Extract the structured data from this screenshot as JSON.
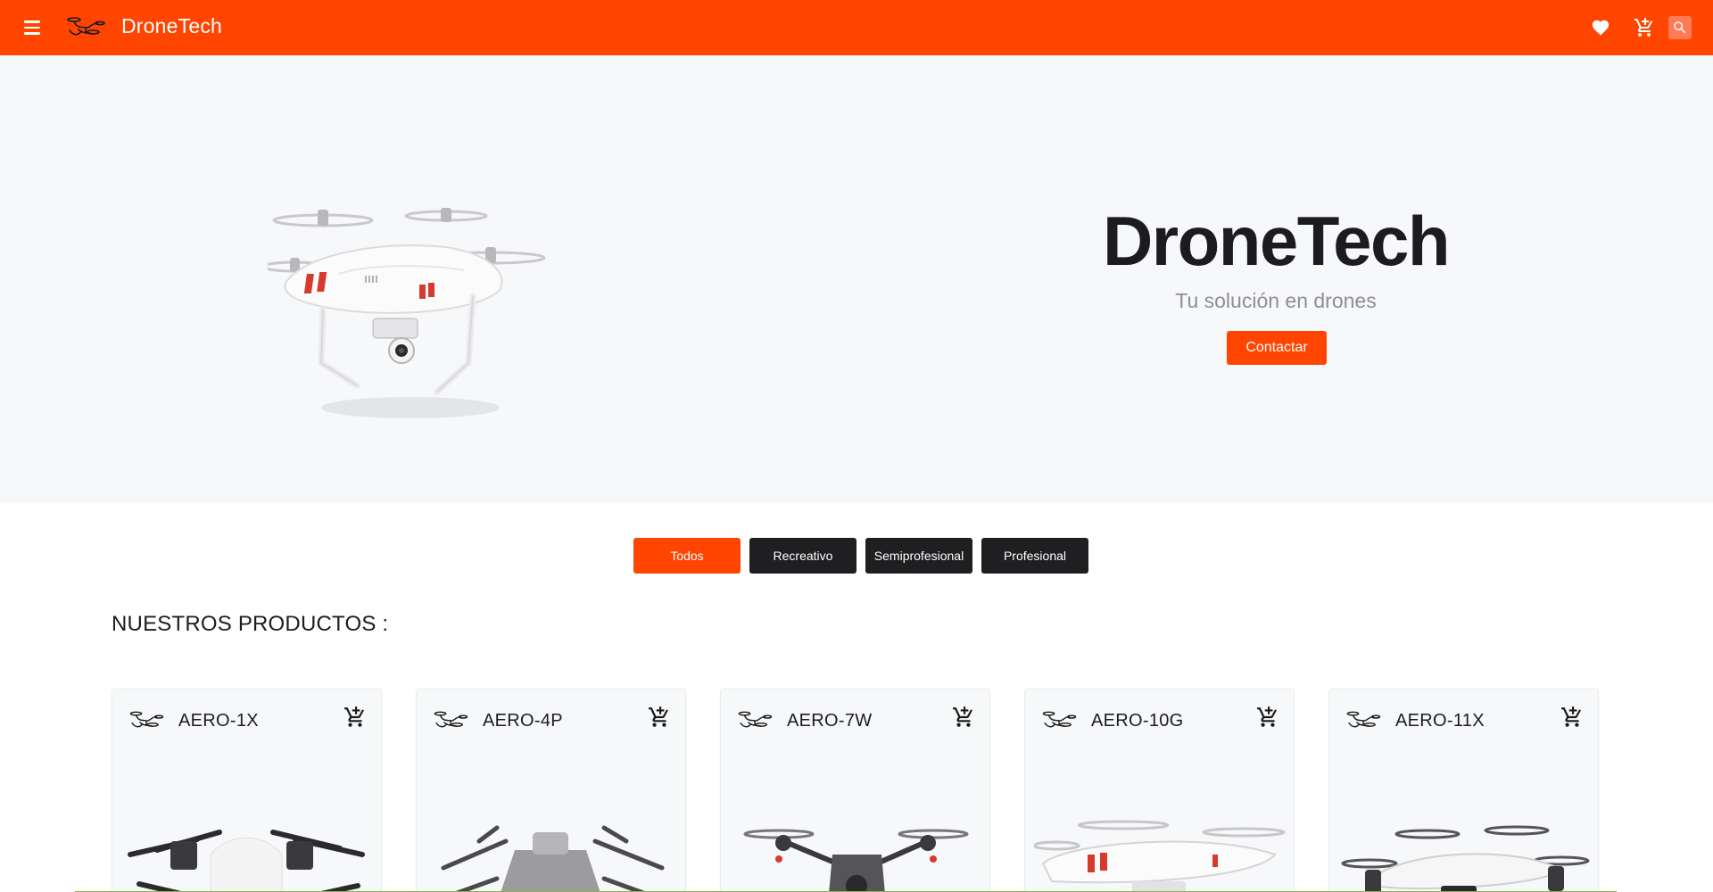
{
  "app": {
    "title": "DroneTech",
    "accent_color": "#ff4500",
    "icons": [
      "menu-icon",
      "drone-logo-icon",
      "heart-icon",
      "cart-icon",
      "search-icon"
    ]
  },
  "hero": {
    "title": "DroneTech",
    "subtitle": "Tu solución en drones",
    "cta_label": "Contactar"
  },
  "filters": [
    {
      "label": "Todos",
      "active": true
    },
    {
      "label": "Recreativo",
      "active": false
    },
    {
      "label": "Semiprofesional",
      "active": false
    },
    {
      "label": "Profesional",
      "active": false
    }
  ],
  "products_section": {
    "title": "NUESTROS PRODUCTOS :"
  },
  "products": [
    {
      "name": "AERO-1X",
      "image": "dark-folding-drone"
    },
    {
      "name": "AERO-4P",
      "image": "gray-folding-drone"
    },
    {
      "name": "AERO-7W",
      "image": "dark-compact-drone"
    },
    {
      "name": "AERO-10G",
      "image": "white-quadcopter-drone"
    },
    {
      "name": "AERO-11X",
      "image": "white-mini-drone"
    }
  ]
}
